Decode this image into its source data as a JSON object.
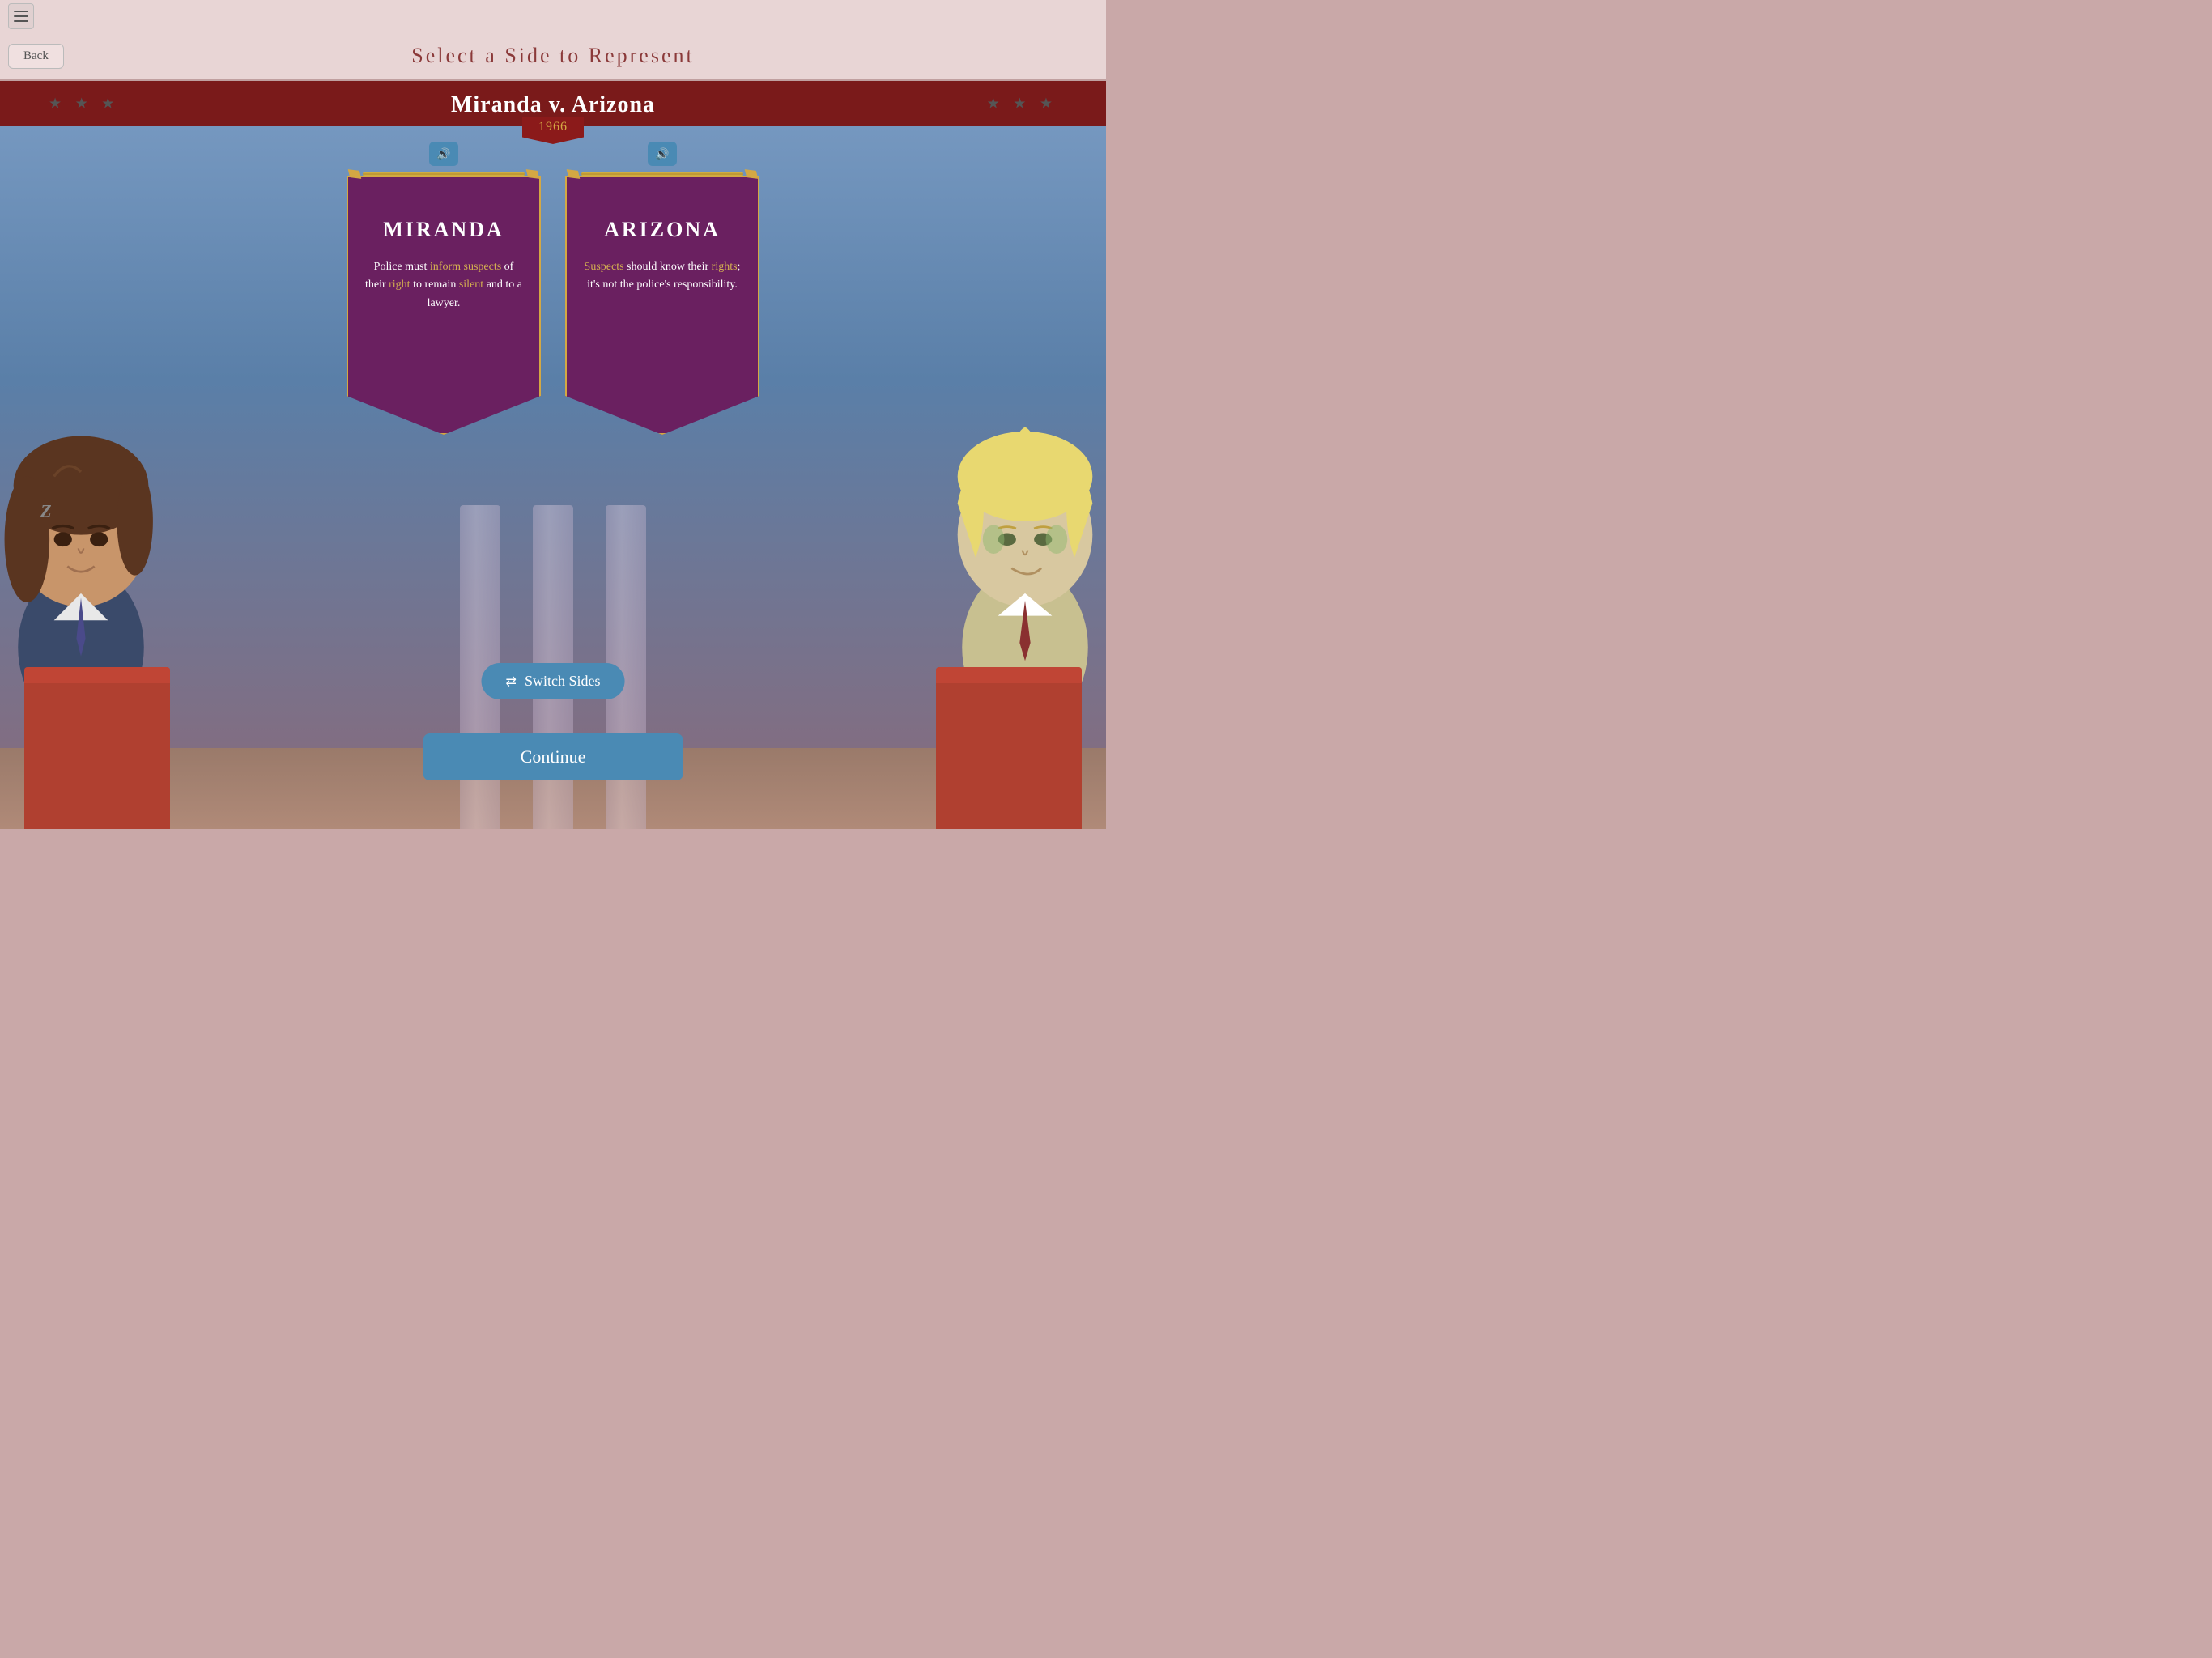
{
  "topBar": {
    "menuIcon": "menu-icon"
  },
  "header": {
    "backLabel": "Back",
    "title": "Select a Side to Represent"
  },
  "main": {
    "caseTitle": "Miranda v. Arizona",
    "year": "1966",
    "leftSide": {
      "name": "MIRANDA",
      "text_plain": "Police must ",
      "text_highlight1": "inform suspects",
      "text_mid1": " of their ",
      "text_highlight2": "right",
      "text_mid2": " to remain ",
      "text_highlight3": "silent",
      "text_end": " and to a lawyer.",
      "fullText": "Police must inform suspects of their right to remain silent and to a lawyer."
    },
    "rightSide": {
      "name": "ARIZONA",
      "text_plain": "",
      "text_highlight1": "Suspects",
      "text_mid1": " should know their ",
      "text_highlight2": "rights",
      "text_end": "; it's not the police's responsibility.",
      "fullText": "Suspects should know their rights; it's not the police's responsibility."
    },
    "switchSidesLabel": "Switch Sides",
    "continueLabel": "Continue"
  }
}
